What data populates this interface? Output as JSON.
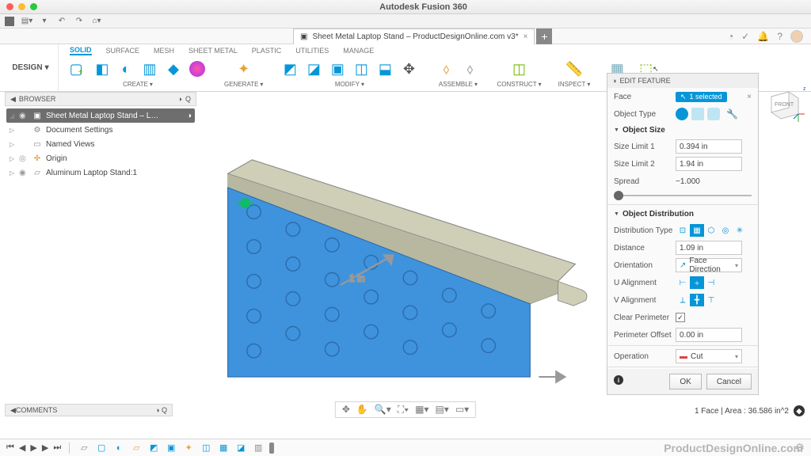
{
  "window": {
    "title": "Autodesk Fusion 360"
  },
  "doc_tab": {
    "label": "Sheet Metal Laptop Stand – ProductDesignOnline.com v3*"
  },
  "design_btn": "DESIGN",
  "workspace_tabs": [
    "SOLID",
    "SURFACE",
    "MESH",
    "SHEET METAL",
    "PLASTIC",
    "UTILITIES",
    "MANAGE"
  ],
  "workspace_active": "SOLID",
  "tool_groups": {
    "create": "CREATE",
    "generate": "GENERATE",
    "modify": "MODIFY",
    "assemble": "ASSEMBLE",
    "construct": "CONSTRUCT",
    "inspect": "INSPECT"
  },
  "browser": {
    "title": "BROWSER",
    "root": "Sheet Metal Laptop Stand – L…",
    "items": [
      "Document Settings",
      "Named Views",
      "Origin",
      "Aluminum Laptop Stand:1"
    ]
  },
  "edit_feature": {
    "title": "EDIT FEATURE",
    "face_label": "Face",
    "face_sel": "1 selected",
    "object_type_label": "Object Type",
    "object_size_h": "Object Size",
    "size1_label": "Size Limit 1",
    "size1_val": "0.394 in",
    "size2_label": "Size Limit 2",
    "size2_val": "1.94 in",
    "spread_label": "Spread",
    "spread_val": "−1.000",
    "dist_h": "Object Distribution",
    "dist_type_label": "Distribution Type",
    "distance_label": "Distance",
    "distance_val": "1.09 in",
    "orientation_label": "Orientation",
    "orientation_val": "Face Direction",
    "u_label": "U Alignment",
    "v_label": "V Alignment",
    "clear_label": "Clear Perimeter",
    "perim_label": "Perimeter Offset",
    "perim_val": "0.00 in",
    "op_label": "Operation",
    "op_val": "Cut",
    "ok": "OK",
    "cancel": "Cancel"
  },
  "viewcube_face": "FRONT",
  "canvas": {
    "dim": "1 in"
  },
  "comments": "COMMENTS",
  "status": {
    "text": "1 Face | Area : 36.586 in^2"
  },
  "watermark": "ProductDesignOnline.com"
}
